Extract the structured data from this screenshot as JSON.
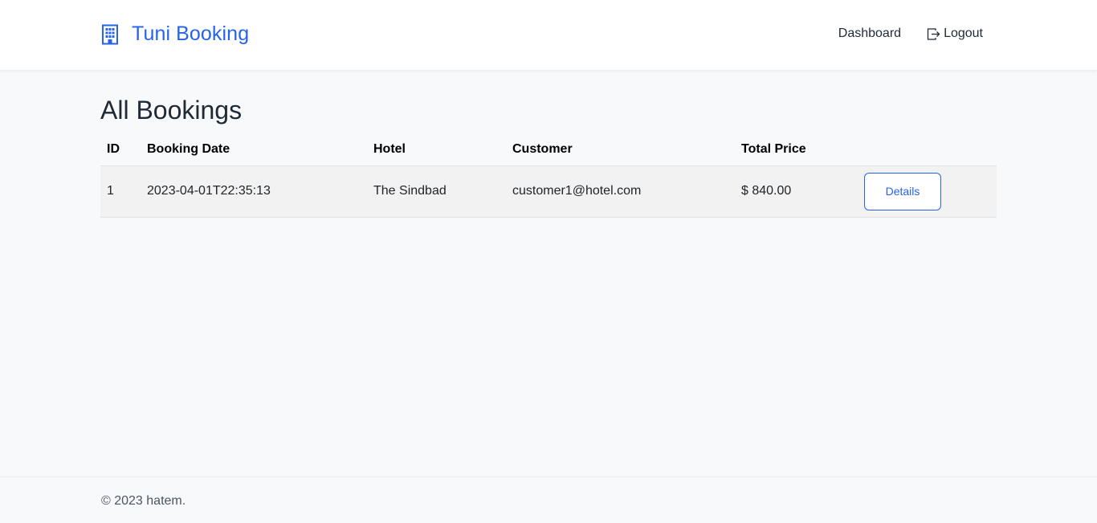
{
  "brand": {
    "name": "Tuni Booking",
    "icon": "building-icon",
    "color": "#2563eb"
  },
  "nav": {
    "dashboard": "Dashboard",
    "logout": "Logout",
    "logout_icon": "logout-icon"
  },
  "page": {
    "title": "All Bookings"
  },
  "table": {
    "headers": [
      "ID",
      "Booking Date",
      "Hotel",
      "Customer",
      "Total Price",
      ""
    ],
    "rows": [
      {
        "id": "1",
        "booking_date": "2023-04-01T22:35:13",
        "hotel": "The Sindbad",
        "customer": "customer1@hotel.com",
        "total_price": "$ 840.00",
        "action_label": "Details"
      }
    ]
  },
  "footer": {
    "text": "© 2023 hatem."
  }
}
